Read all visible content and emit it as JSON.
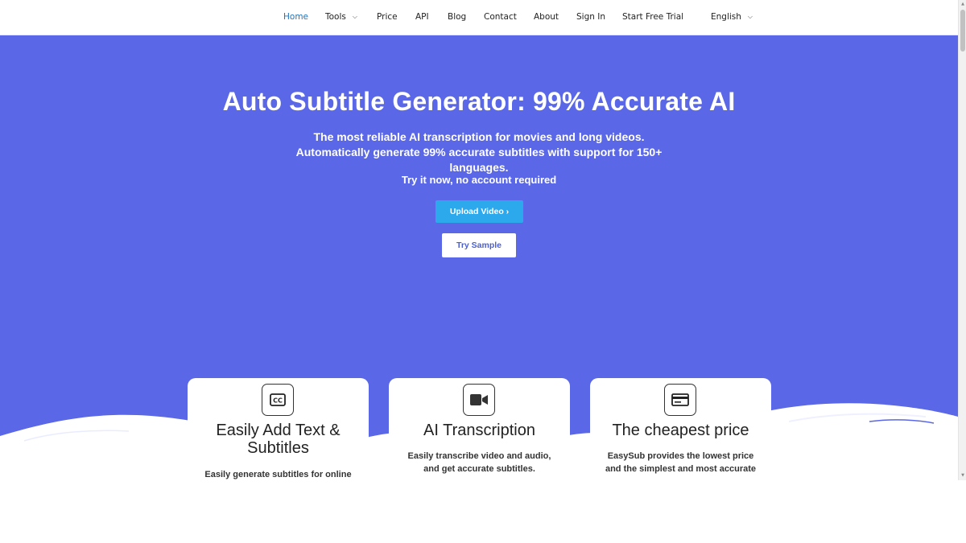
{
  "nav": {
    "items": [
      {
        "label": "Home",
        "active": true
      },
      {
        "label": "Tools",
        "dropdown": true
      },
      {
        "label": "Price"
      },
      {
        "label": "API"
      },
      {
        "label": "Blog"
      },
      {
        "label": "Contact"
      },
      {
        "label": "About"
      },
      {
        "label": "Sign In"
      },
      {
        "label": "Start Free Trial"
      }
    ],
    "language": "English"
  },
  "hero": {
    "title": "Auto Subtitle Generator: 99% Accurate AI",
    "subtitle": "The most reliable AI transcription for movies and long videos. Automatically generate 99% accurate subtitles with support for 150+ languages.",
    "note": "Try it now, no account required",
    "upload_button": "Upload Video ›",
    "sample_button": "Try Sample"
  },
  "features": [
    {
      "icon": "closed-captions-icon",
      "title": "Easily Add Text & Subtitles",
      "text": "Easily generate subtitles for online"
    },
    {
      "icon": "video-camera-icon",
      "title": "AI Transcription",
      "text": "Easily transcribe video and audio, and get accurate subtitles."
    },
    {
      "icon": "credit-card-icon",
      "title": "The cheapest price",
      "text": "EasySub provides the lowest price and the simplest and most accurate"
    }
  ],
  "colors": {
    "hero_bg": "#5a67e6",
    "upload_button": "#2ca8ec",
    "nav_active": "#1e73be",
    "sample_text": "#4a5fd6"
  }
}
